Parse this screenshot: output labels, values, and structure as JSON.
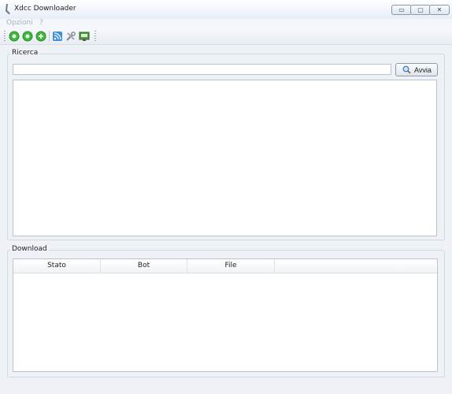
{
  "window": {
    "title": "Xdcc Downloader",
    "controls": {
      "minimize": "▭",
      "maximize": "▢",
      "close": "✕"
    }
  },
  "menu": {
    "items": [
      "Opzioni",
      "?"
    ]
  },
  "toolbar": {
    "buttons": [
      {
        "icon": "green-circle-icon",
        "color": "#3fb93c"
      },
      {
        "icon": "green-circle-icon",
        "color": "#3fb93c"
      },
      {
        "icon": "green-circle-icon",
        "color": "#3fb93c"
      },
      {
        "icon": "rss-feed-icon",
        "color": "#3a8fd8"
      },
      {
        "icon": "tools-icon",
        "color": "#8a8f96"
      },
      {
        "icon": "monitor-icon",
        "color": "#4f9a3c"
      }
    ]
  },
  "search": {
    "group_label": "Ricerca",
    "input_value": "",
    "button_label": "Avvia"
  },
  "download": {
    "group_label": "Download",
    "columns": [
      "Stato",
      "Bot",
      "File"
    ],
    "rows": []
  }
}
